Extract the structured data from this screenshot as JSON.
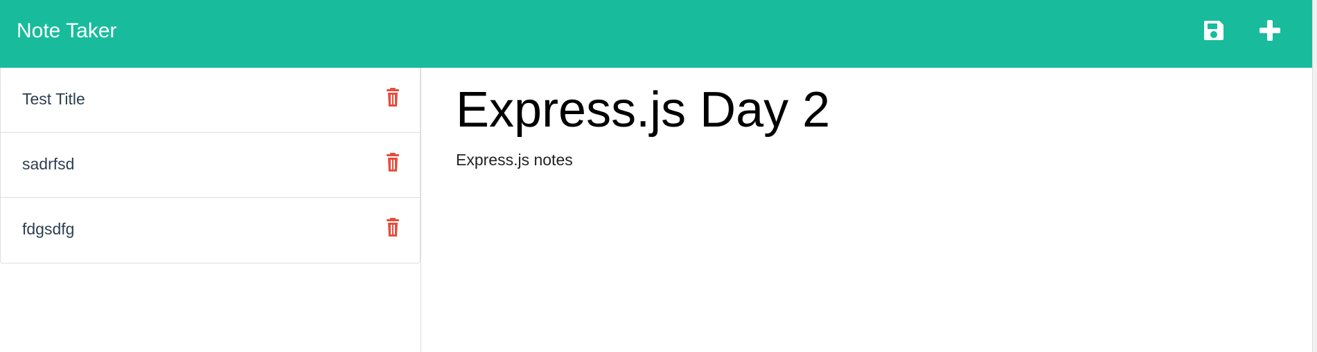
{
  "app": {
    "title": "Note Taker",
    "accent_color": "#18bc9c",
    "delete_color": "#e74c3c"
  },
  "header": {
    "save_icon": "save-icon",
    "new_icon": "plus-icon"
  },
  "sidebar": {
    "notes": [
      {
        "title": "Test Title",
        "icon": "trash-icon"
      },
      {
        "title": "sadrfsd",
        "icon": "trash-icon"
      },
      {
        "title": "fdgsdfg",
        "icon": "trash-icon"
      }
    ]
  },
  "editor": {
    "title": "Express.js Day 2",
    "body": "Express.js notes"
  }
}
